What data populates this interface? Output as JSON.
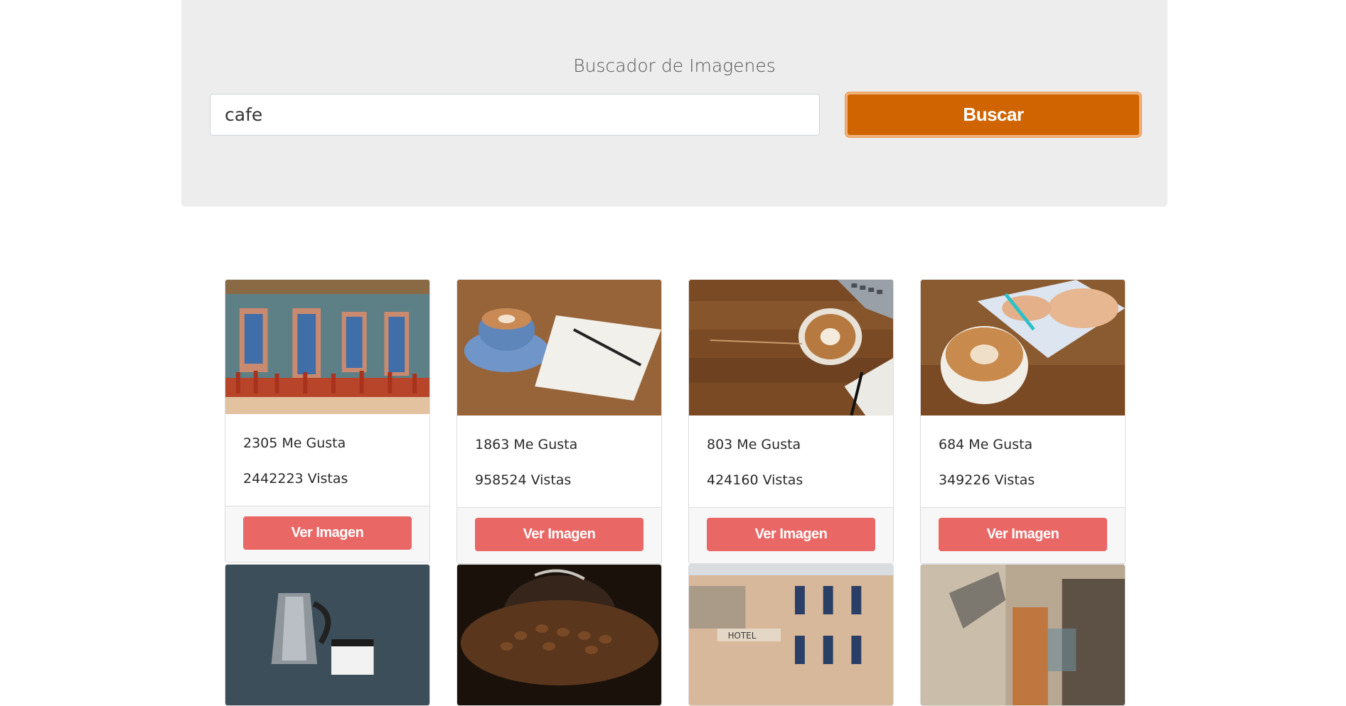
{
  "search": {
    "title": "Buscador de Imagenes",
    "query": "cafe",
    "button_label": "Buscar"
  },
  "results": [
    {
      "likes": "2305 Me Gusta",
      "views": "2442223 Vistas",
      "button": "Ver Imagen",
      "image": "cafe-street-photo"
    },
    {
      "likes": "1863 Me Gusta",
      "views": "958524 Vistas",
      "button": "Ver Imagen",
      "image": "coffee-cup-notebook-photo"
    },
    {
      "likes": "803 Me Gusta",
      "views": "424160 Vistas",
      "button": "Ver Imagen",
      "image": "latte-on-wooden-table-photo"
    },
    {
      "likes": "684 Me Gusta",
      "views": "349226 Vistas",
      "button": "Ver Imagen",
      "image": "latte-hand-writing-photo"
    },
    {
      "image": "moka-pot-photo"
    },
    {
      "image": "coffee-beans-glass-photo"
    },
    {
      "image": "hotel-building-photo"
    },
    {
      "image": "blurred-street-photo"
    }
  ],
  "colors": {
    "search_button": "#cf6400",
    "view_button": "#e96866",
    "jumbotron": "#ededed"
  }
}
